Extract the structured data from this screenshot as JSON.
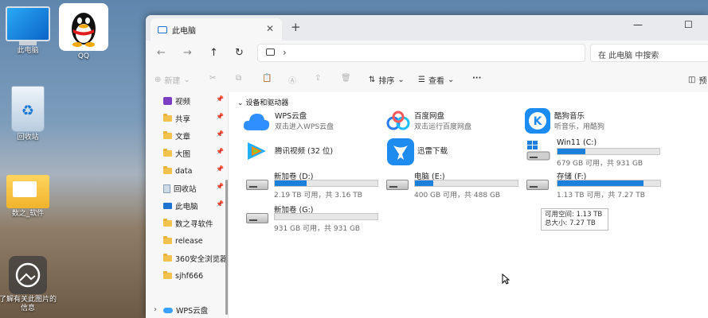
{
  "desktop": {
    "icons": [
      {
        "name": "此电脑",
        "label": "此电脑"
      },
      {
        "name": "QQ",
        "label": "QQ"
      },
      {
        "name": "回收站",
        "label": "回收站"
      },
      {
        "name": "folder",
        "label": "数之_软件"
      },
      {
        "name": "photo",
        "label": "了解有关此图片的信息"
      }
    ]
  },
  "window": {
    "tab_title": "此电脑",
    "search_placeholder": "在 此电脑 中搜索",
    "toolbar": {
      "new": "新建",
      "sort": "排序",
      "view": "查看",
      "more": "···",
      "preview": "预"
    },
    "sidebar": [
      {
        "label": "视频",
        "pinned": true
      },
      {
        "label": "共享",
        "pinned": true
      },
      {
        "label": "文章",
        "pinned": true
      },
      {
        "label": "大图",
        "pinned": true
      },
      {
        "label": "data",
        "pinned": true
      },
      {
        "label": "回收站",
        "pinned": true
      },
      {
        "label": "此电脑",
        "pinned": true
      },
      {
        "label": "数之寻软件",
        "pinned": false
      },
      {
        "label": "release",
        "pinned": false
      },
      {
        "label": "360安全浏览器",
        "pinned": false
      },
      {
        "label": "sjhf666",
        "pinned": false
      },
      {
        "label": "WPS云盘",
        "pinned": false
      }
    ],
    "section_title": "设备和驱动器",
    "apps": [
      {
        "name": "WPS云盘",
        "sub": "双击进入WPS云盘"
      },
      {
        "name": "百度网盘",
        "sub": "双击运行百度网盘"
      },
      {
        "name": "酷狗音乐",
        "sub": "听音乐，用酷狗"
      },
      {
        "name": "腾讯视频 (32 位)",
        "sub": ""
      },
      {
        "name": "迅雷下载",
        "sub": ""
      }
    ],
    "drives": [
      {
        "name": "Win11 (C:)",
        "sub": "679 GB 可用，共 931 GB",
        "used": 0.27
      },
      {
        "name": "新加卷 (D:)",
        "sub": "2.19 TB 可用，共 3.16 TB",
        "used": 0.31
      },
      {
        "name": "电脑 (E:)",
        "sub": "400 GB 可用，共 488 GB",
        "used": 0.18
      },
      {
        "name": "存储 (F:)",
        "sub": "1.13 TB 可用，共 7.27 TB",
        "used": 0.84
      },
      {
        "name": "新加卷 (G:)",
        "sub": "931 GB 可用，共 931 GB",
        "used": 0.0
      }
    ],
    "tooltip": {
      "line1": "可用空间: 1.13 TB",
      "line2": "总大小: 7.27 TB"
    }
  }
}
